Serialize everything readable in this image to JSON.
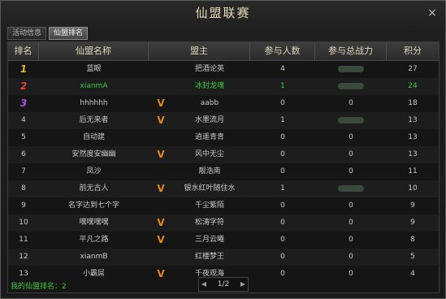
{
  "window": {
    "title": "仙盟联赛",
    "close": "×"
  },
  "tabs": [
    {
      "label": "活动信息",
      "active": false
    },
    {
      "label": "仙盟排名",
      "active": true
    }
  ],
  "table": {
    "headers": [
      "排名",
      "仙盟名称",
      "盟主",
      "参与人数",
      "参与总战力",
      "积分"
    ],
    "rows": [
      {
        "rank": "1",
        "name": "蓝眼",
        "vip": false,
        "leader": "把酒论英",
        "participants": "4",
        "power": "",
        "score": "27",
        "highlight": false,
        "rank_style": "gold"
      },
      {
        "rank": "2",
        "name": "xianmA",
        "vip": false,
        "leader": "冰封龙魂",
        "participants": "1",
        "power": "",
        "score": "24",
        "highlight": true,
        "rank_style": "red"
      },
      {
        "rank": "3",
        "name": "hhhhhh",
        "vip": true,
        "leader": "aabb",
        "participants": "0",
        "power": "0",
        "score": "18",
        "highlight": false,
        "rank_style": "purple"
      },
      {
        "rank": "4",
        "name": "后无来者",
        "vip": true,
        "leader": "水墨流月",
        "participants": "1",
        "power": "",
        "score": "13",
        "highlight": false,
        "rank_style": "plain"
      },
      {
        "rank": "5",
        "name": "自动建",
        "vip": false,
        "leader": "逍遥青青",
        "participants": "0",
        "power": "0",
        "score": "13",
        "highlight": false,
        "rank_style": "plain"
      },
      {
        "rank": "6",
        "name": "安然度安幽幽",
        "vip": true,
        "leader": "风中无尘",
        "participants": "0",
        "power": "0",
        "score": "13",
        "highlight": false,
        "rank_style": "plain"
      },
      {
        "rank": "7",
        "name": "凤沙",
        "vip": false,
        "leader": "靓浩南",
        "participants": "0",
        "power": "0",
        "score": "11",
        "highlight": false,
        "rank_style": "plain"
      },
      {
        "rank": "8",
        "name": "前无古人",
        "vip": true,
        "leader": "银水红叶随住水",
        "participants": "1",
        "power": "",
        "score": "10",
        "highlight": false,
        "rank_style": "plain"
      },
      {
        "rank": "9",
        "name": "名字达到七个字",
        "vip": false,
        "leader": "千尘紫陌",
        "participants": "0",
        "power": "0",
        "score": "9",
        "highlight": false,
        "rank_style": "plain"
      },
      {
        "rank": "10",
        "name": "嘿嘿嘿嘿",
        "vip": true,
        "leader": "松涛字符",
        "participants": "0",
        "power": "0",
        "score": "9",
        "highlight": false,
        "rank_style": "plain"
      },
      {
        "rank": "11",
        "name": "平凡之路",
        "vip": true,
        "leader": "三月云曦",
        "participants": "0",
        "power": "0",
        "score": "8",
        "highlight": false,
        "rank_style": "plain"
      },
      {
        "rank": "12",
        "name": "xianmB",
        "vip": false,
        "leader": "红楼梦王",
        "participants": "0",
        "power": "0",
        "score": "5",
        "highlight": false,
        "rank_style": "plain"
      },
      {
        "rank": "13",
        "name": "小霸屌",
        "vip": true,
        "leader": "千夜观海",
        "participants": "0",
        "power": "0",
        "score": "4",
        "highlight": false,
        "rank_style": "plain"
      }
    ]
  },
  "footer": {
    "my_rank": "我的仙盟排名：2"
  },
  "pager": {
    "text": "1/2",
    "prev": "◀",
    "next": "▶"
  },
  "colors": {
    "gold": "#e6b43a",
    "red": "#e04030",
    "purple": "#b050e8",
    "highlight": "#3fc83f",
    "vip": "#e08a1e"
  }
}
